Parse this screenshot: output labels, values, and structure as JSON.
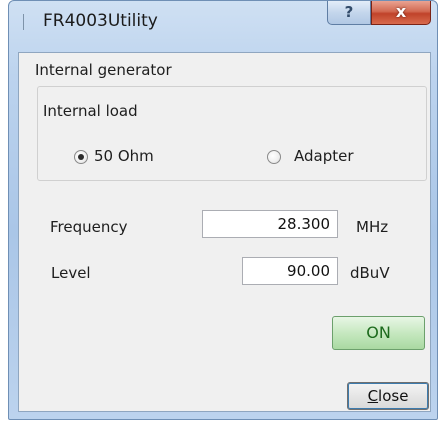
{
  "window": {
    "title": "FR4003Utility",
    "help_glyph": "?",
    "close_glyph": "x"
  },
  "generator": {
    "section_label": "Internal generator",
    "group_label": "Internal load",
    "radio_50ohm_label": "50 Ohm",
    "radio_50ohm_selected": true,
    "radio_adapter_label": "Adapter",
    "radio_adapter_selected": false
  },
  "frequency": {
    "label": "Frequency",
    "value": "28.300",
    "unit": "MHz"
  },
  "level": {
    "label": "Level",
    "value": "90.00",
    "unit": "dBuV"
  },
  "buttons": {
    "on_label": "ON",
    "close_label_mnemonic": "C",
    "close_label_rest": "lose"
  }
}
